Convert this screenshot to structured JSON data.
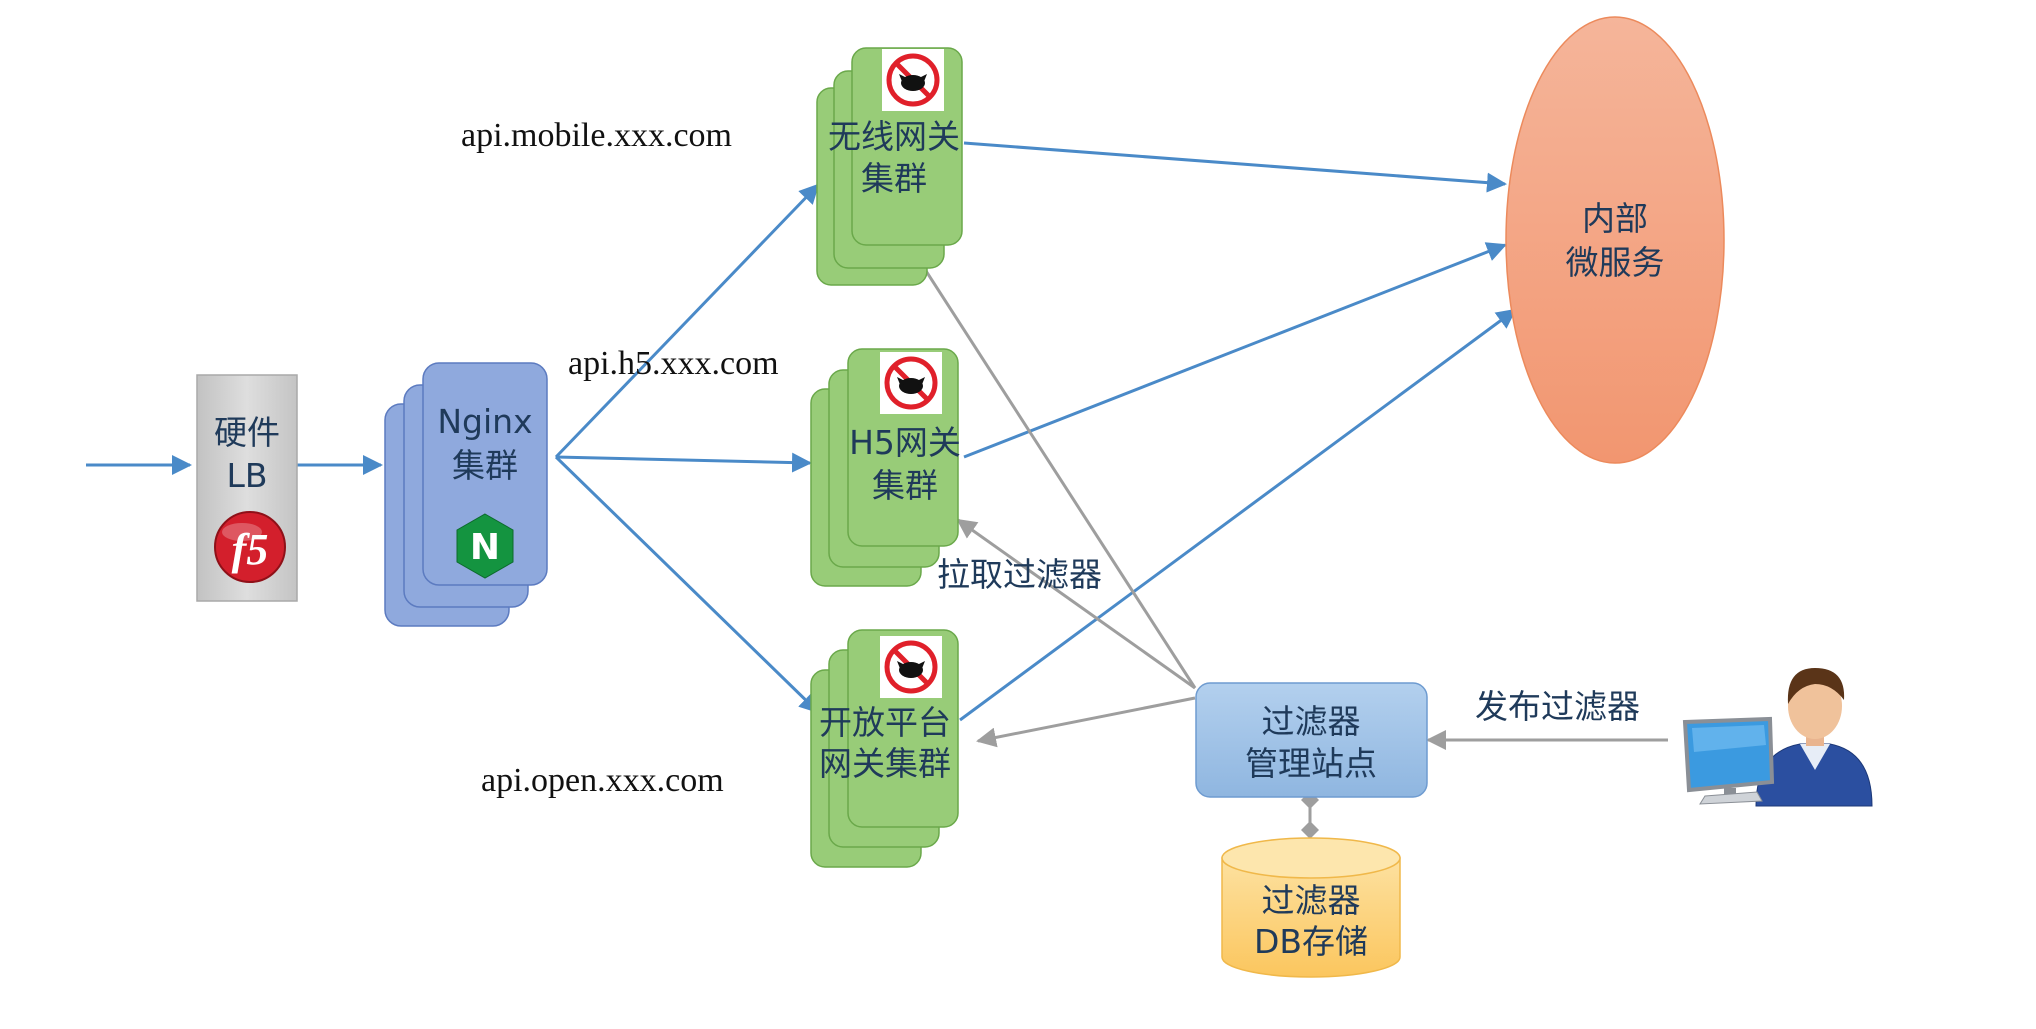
{
  "lb": {
    "line1": "硬件",
    "line2": "LB",
    "logo_text": "f5",
    "icon": "f5-logo-icon"
  },
  "nginx": {
    "line1": "Nginx",
    "line2": "集群",
    "icon": "nginx-logo-icon",
    "icon_letter": "N"
  },
  "gateways": {
    "wireless": {
      "line1": "无线网关",
      "line2": "集群",
      "domain": "api.mobile.xxx.com",
      "icon": "zuul-logo-icon"
    },
    "h5": {
      "line1": "H5网关",
      "line2": "集群",
      "domain": "api.h5.xxx.com",
      "icon": "zuul-logo-icon"
    },
    "open": {
      "line1": "开放平台",
      "line2": "网关集群",
      "domain": "api.open.xxx.com",
      "icon": "zuul-logo-icon"
    }
  },
  "microservices": {
    "line1": "内部",
    "line2": "微服务"
  },
  "filter_admin": {
    "line1": "过滤器",
    "line2": "管理站点"
  },
  "filter_db": {
    "line1": "过滤器",
    "line2": "DB存储"
  },
  "labels": {
    "pull_filters": "拉取过滤器",
    "publish_filters": "发布过滤器"
  },
  "user": {
    "icon": "user-at-computer-icon"
  },
  "colors": {
    "blue_arrow": "#4a8ac8",
    "gray_arrow": "#9e9e9e",
    "lb_fill": "#cdcdcd",
    "nginx_fill": "#8fa9dd",
    "gateway_fill": "#98cc78",
    "microservice_fill": "#f4a47c",
    "admin_fill": "#9dc0e6",
    "db_fill": "#fcd37c",
    "text_dark": "#1f3a5a"
  }
}
